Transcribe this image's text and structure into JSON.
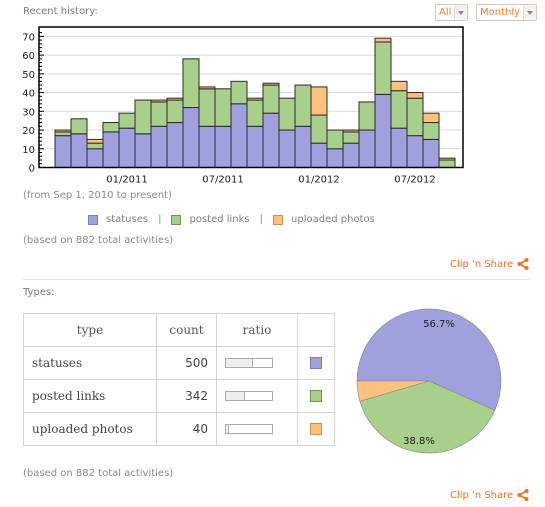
{
  "header": {
    "title": "Recent history:",
    "filter_select": "All",
    "period_select": "Monthly"
  },
  "history": {
    "range_note": "(from Sep 1, 2010 to present)",
    "total_note": "(based on 882 total activities)",
    "clip_label": "Clip 'n Share"
  },
  "types_section": {
    "title": "Types:",
    "columns": [
      "type",
      "count",
      "ratio",
      ""
    ],
    "rows": [
      {
        "type": "statuses",
        "count": "500",
        "ratio": 0.567,
        "color": "#a0a0dc"
      },
      {
        "type": "posted links",
        "count": "342",
        "ratio": 0.388,
        "color": "#a8cf8c"
      },
      {
        "type": "uploaded photos",
        "count": "40",
        "ratio": 0.045,
        "color": "#fcc080"
      }
    ],
    "total_note": "(based on 882 total activities)",
    "clip_label": "Clip 'n Share"
  },
  "colors": {
    "statuses": "#a0a0dc",
    "posted_links": "#a8cf8c",
    "uploaded_photos": "#fcc080",
    "accent": "#f07020"
  },
  "chart_data": [
    {
      "type": "bar",
      "stacked": true,
      "title": "Recent history",
      "xlabel": "",
      "ylabel": "",
      "categories": [
        "09/2010",
        "10/2010",
        "11/2010",
        "12/2010",
        "01/2011",
        "02/2011",
        "03/2011",
        "04/2011",
        "05/2011",
        "06/2011",
        "07/2011",
        "08/2011",
        "09/2011",
        "10/2011",
        "11/2011",
        "12/2011",
        "01/2012",
        "02/2012",
        "03/2012",
        "04/2012",
        "05/2012",
        "06/2012",
        "07/2012",
        "08/2012",
        "09/2012"
      ],
      "xtick_labels": [
        "01/2011",
        "07/2011",
        "01/2012",
        "07/2012"
      ],
      "xtick_positions": [
        "01/2011",
        "07/2011",
        "01/2012",
        "07/2012"
      ],
      "yticks": [
        0,
        10,
        20,
        30,
        40,
        50,
        60,
        70
      ],
      "ylim": [
        0,
        75
      ],
      "grid": true,
      "series": [
        {
          "name": "statuses",
          "color": "#a0a0dc",
          "values": [
            17,
            18,
            10,
            19,
            21,
            18,
            22,
            24,
            32,
            22,
            22,
            34,
            22,
            29,
            20,
            22,
            13,
            10,
            13,
            20,
            39,
            21,
            17,
            15,
            0
          ]
        },
        {
          "name": "posted links",
          "color": "#a8cf8c",
          "values": [
            2,
            8,
            3,
            5,
            8,
            18,
            13,
            12,
            26,
            20,
            20,
            12,
            14,
            15,
            17,
            22,
            15,
            10,
            6,
            15,
            28,
            20,
            20,
            9,
            4
          ]
        },
        {
          "name": "uploaded photos",
          "color": "#fcc080",
          "values": [
            1,
            0,
            2,
            0,
            0,
            0,
            1,
            1,
            0,
            1,
            0,
            0,
            1,
            1,
            0,
            0,
            15,
            0,
            1,
            0,
            2,
            5,
            3,
            5,
            1
          ]
        }
      ],
      "legend": [
        "statuses",
        "posted links",
        "uploaded photos"
      ],
      "legend_position": "bottom"
    },
    {
      "type": "pie",
      "title": "Types",
      "labels": [
        "statuses",
        "posted links",
        "uploaded photos"
      ],
      "values": [
        500,
        342,
        40
      ],
      "percent_labels": [
        "56.7%",
        "38.8%",
        ""
      ],
      "colors": [
        "#a0a0dc",
        "#a8cf8c",
        "#fcc080"
      ]
    }
  ]
}
